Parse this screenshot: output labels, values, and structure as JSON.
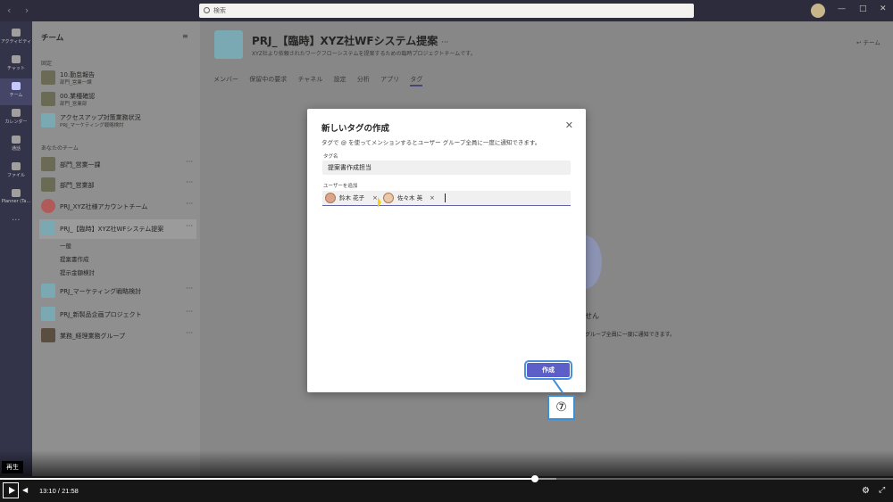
{
  "topbar": {
    "search_placeholder": "検索",
    "nav_back": "‹",
    "nav_forward": "›",
    "win_min": "—",
    "win_max": "□",
    "win_close": "✕"
  },
  "rail": {
    "items": [
      {
        "label": "アクティビティ",
        "icon": "bell-icon"
      },
      {
        "label": "チャット",
        "icon": "chat-icon"
      },
      {
        "label": "チーム",
        "icon": "teams-icon"
      },
      {
        "label": "カレンダー",
        "icon": "calendar-icon"
      },
      {
        "label": "通話",
        "icon": "phone-icon"
      },
      {
        "label": "ファイル",
        "icon": "file-icon"
      },
      {
        "label": "Planner (Ta...",
        "icon": "planner-icon"
      }
    ],
    "more": "···"
  },
  "panel": {
    "title": "チーム",
    "filter_icon": "filter-icon",
    "section_pinned": "固定",
    "section_teams": "あなたのチーム",
    "pinned": [
      {
        "name": "10.勤怠報告",
        "sub": "部門_営業一課"
      },
      {
        "name": "00.業種確認",
        "sub": "部門_営業部"
      },
      {
        "name": "アクセスアップ対策業務状況",
        "sub": "PRJ_マーケティング戦略検討"
      }
    ],
    "teams": [
      {
        "name": "部門_営業一課",
        "more": "···"
      },
      {
        "name": "部門_営業部",
        "more": "···"
      },
      {
        "name": "PRJ_XYZ社様アカウントチーム",
        "more": "···"
      },
      {
        "name": "PRJ_【臨時】XYZ社WFシステム提案",
        "more": "···"
      },
      {
        "name": "PRJ_マーケティング戦略検討",
        "more": "···"
      },
      {
        "name": "PRJ_新製品企画プロジェクト",
        "more": "···"
      },
      {
        "name": "業務_経理業務グループ",
        "more": "···"
      }
    ],
    "channels": [
      "一般",
      "提案書作成",
      "提示金額検討"
    ]
  },
  "main": {
    "team_title": "PRJ_【臨時】XYZ社WFシステム提案",
    "team_title_more": "···",
    "team_desc": "XYZ社より依頼されたワークフローシステムを提案するための臨時プロジェクトチームです。",
    "side_link": "チーム",
    "tabs": [
      "メンバー",
      "保留中の要求",
      "チャネル",
      "設定",
      "分析",
      "アプリ",
      "タグ"
    ],
    "selected_tab": "タグ",
    "bg_text1": "せん",
    "bg_text2": "グループ全員に一度に通知できます。"
  },
  "dialog": {
    "title": "新しいタグの作成",
    "close": "✕",
    "description": "タグで @ を使ってメンションするとユーザー グループ全員に一度に通知できます。",
    "tag_label": "タグ名",
    "tag_value": "提案書作成担当",
    "users_label": "ユーザーを追加",
    "chips": [
      {
        "name": "鈴木 花子",
        "remove": "×"
      },
      {
        "name": "佐々木 英",
        "remove": "×"
      }
    ],
    "create_button": "作成"
  },
  "annotation": {
    "step": "⑦"
  },
  "video": {
    "tooltip": "再生",
    "current_time": "13:10",
    "separator": "/",
    "duration": "21:58",
    "progress_fraction": 0.599,
    "buffered_fraction": 0.623
  }
}
